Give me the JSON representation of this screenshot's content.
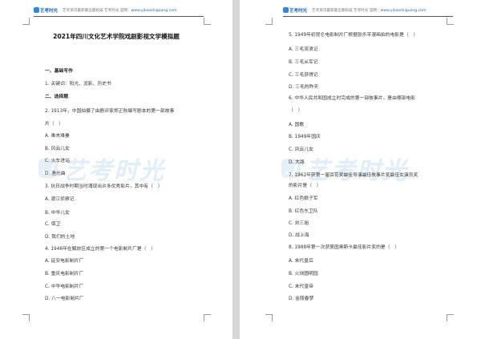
{
  "header": {
    "logo": "艺考时光",
    "text": "艺考资讯最新最全最权威 艺考时光 官网：",
    "url": "www.yikaoshiguang.com"
  },
  "watermark": {
    "text": "艺考时光"
  },
  "left_page": {
    "title": "2021年四川文化艺术学院戏剧影视文学模拟题",
    "lines": [
      {
        "text": "一、基础写作",
        "bold": true
      },
      {
        "text": "1. 关键词：阳光、泥影、历史书"
      },
      {
        "text": "二、选择题",
        "bold": true
      },
      {
        "text": "2. 1913年，中国拍摄了由剧评家郑正秋编写剧本的第一部故事"
      },
      {
        "text": "片（　）"
      },
      {
        "text": "A. 难夫难妻"
      },
      {
        "text": "B. 风云儿女"
      },
      {
        "text": "C. 火车进站"
      },
      {
        "text": "D. 渔光曲"
      },
      {
        "text": "3. 抗日战争时期当时涌现出许多优秀影片，其中有（　）"
      },
      {
        "text": "A. 渡江侦察记"
      },
      {
        "text": "B. 中华儿女"
      },
      {
        "text": "C. 保卫"
      },
      {
        "text": "D. 我们的土地"
      },
      {
        "text": "4. 1946年在解放区成立的第一个电影制片厂是（　）"
      },
      {
        "text": "A. 延安电影制片厂"
      },
      {
        "text": "B. 重庆电影制片厂"
      },
      {
        "text": "C. 中华电影制片厂"
      },
      {
        "text": "D. 八一电影制片厂"
      }
    ]
  },
  "right_page": {
    "lines": [
      {
        "text": "5. 1949年初昆仑电影制片厂根据张乐平漫画拍的电影是（　）"
      },
      {
        "text": "A. 三毛流浪记"
      },
      {
        "text": "B. 三毛从军记"
      },
      {
        "text": "C. 三毛获得记"
      },
      {
        "text": "D. 三毛的昨天"
      },
      {
        "text": "6. 中华人民共和国成立时完成的第一部故事片，是由哪部电影"
      },
      {
        "text": "（　）"
      },
      {
        "text": "A. 国歌"
      },
      {
        "text": "B. 1949年国庆"
      },
      {
        "text": "C. 风云儿女"
      },
      {
        "text": "D. 大路"
      },
      {
        "text": "7. 1962年获第一届百花奖最佳导演最佳故事片奖最佳女演员奖"
      },
      {
        "text": "的影片是（　）"
      },
      {
        "text": "A. 红色娘子军"
      },
      {
        "text": "B. 红色东卫队"
      },
      {
        "text": "C. 刘三姐"
      },
      {
        "text": "D. 战上海"
      },
      {
        "text": "8. 1988年第一次获美国奥斯卡最佳影片奖的是（　）"
      },
      {
        "text": "A. 末代皇后"
      },
      {
        "text": "B. 火烧圆明园"
      },
      {
        "text": "C. 末代皇帝"
      },
      {
        "text": "D. 金陵春梦"
      }
    ]
  }
}
